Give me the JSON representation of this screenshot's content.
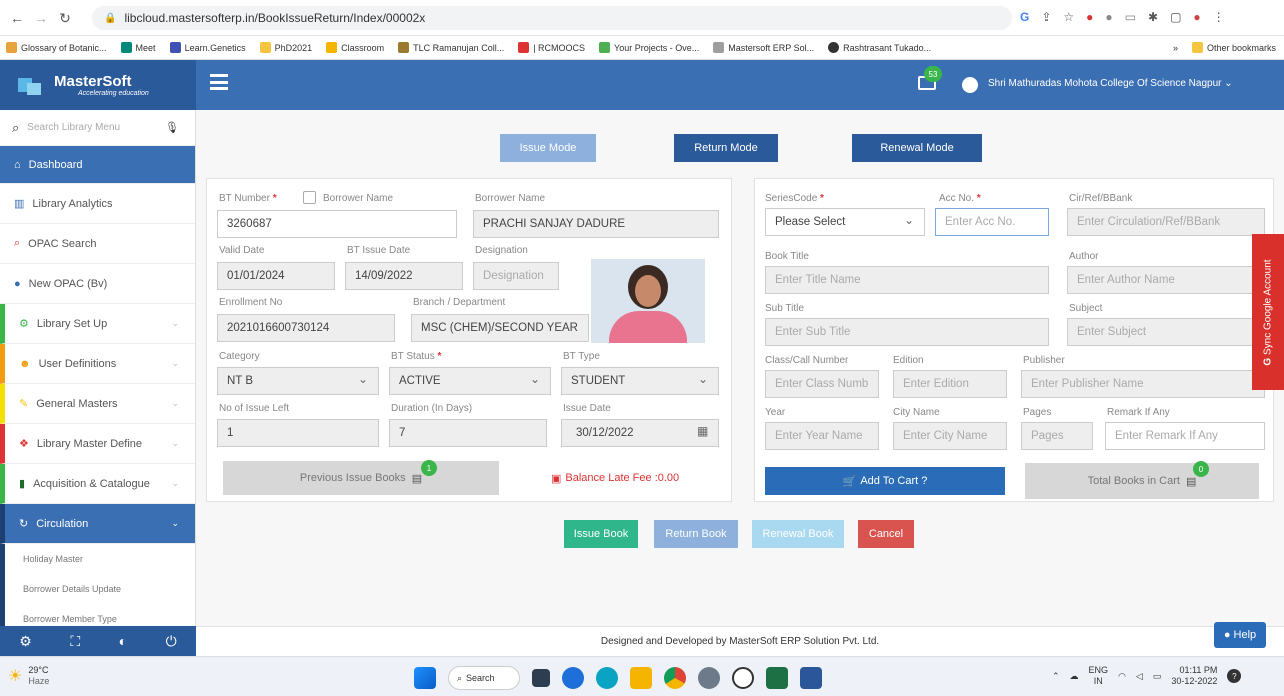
{
  "browser": {
    "url": "libcloud.mastersofterp.in/BookIssueReturn/Index/00002x",
    "bookmarks": [
      "Glossary of Botanic...",
      "Meet",
      "Learn.Genetics",
      "PhD2021",
      "Classroom",
      "TLC Ramanujan Coll...",
      "| RCMOOCS",
      "Your Projects - Ove...",
      "Mastersoft ERP Sol...",
      "Rashtrasant Tukado..."
    ],
    "other_bookmarks": "Other bookmarks"
  },
  "header": {
    "logo": "MasterSoft",
    "logo_tagline": "Accelerating education",
    "notification_count": "53",
    "college": "Shri Mathuradas Mohota College Of Science Nagpur"
  },
  "sidebar": {
    "search_placeholder": "Search Library Menu",
    "items": [
      {
        "label": "Dashboard"
      },
      {
        "label": "Library Analytics"
      },
      {
        "label": "OPAC Search"
      },
      {
        "label": "New OPAC (Bv)"
      },
      {
        "label": "Library Set Up"
      },
      {
        "label": "User Definitions"
      },
      {
        "label": "General Masters"
      },
      {
        "label": "Library Master Define"
      },
      {
        "label": "Acquisition & Catalogue"
      },
      {
        "label": "Circulation"
      }
    ],
    "sub_items": [
      "Holiday Master",
      "Borrower Details Update",
      "Borrower Member Type"
    ]
  },
  "modes": {
    "issue": "Issue Mode",
    "return": "Return Mode",
    "renewal": "Renewal Mode"
  },
  "left_form": {
    "bt_number_label": "BT Number",
    "bt_number": "3260687",
    "borrower_name_check_label": "Borrower Name",
    "borrower_name_label": "Borrower Name",
    "borrower_name": "PRACHI SANJAY DADURE",
    "valid_date_label": "Valid Date",
    "valid_date": "01/01/2024",
    "bt_issue_date_label": "BT Issue Date",
    "bt_issue_date": "14/09/2022",
    "designation_label": "Designation",
    "designation_placeholder": "Designation",
    "enrollment_label": "Enrollment No",
    "enrollment": "2021016600730124",
    "branch_label": "Branch / Department",
    "branch": "MSC (CHEM)/SECOND YEAR",
    "category_label": "Category",
    "category": "NT B",
    "bt_status_label": "BT Status",
    "bt_status": "ACTIVE",
    "bt_type_label": "BT Type",
    "bt_type": "STUDENT",
    "issue_left_label": "No of Issue Left",
    "issue_left": "1",
    "duration_label": "Duration (In Days)",
    "duration": "7",
    "issue_date_label": "Issue Date",
    "issue_date": "30/12/2022",
    "prev_issue_label": "Previous Issue Books",
    "prev_issue_count": "1",
    "late_fee": "Balance Late Fee :0.00"
  },
  "right_form": {
    "series_label": "SeriesCode",
    "series_value": "Please Select",
    "acc_label": "Acc No.",
    "acc_placeholder": "Enter Acc No.",
    "cir_label": "Cir/Ref/BBank",
    "cir_placeholder": "Enter Circulation/Ref/BBank",
    "title_label": "Book Title",
    "title_placeholder": "Enter Title Name",
    "author_label": "Author",
    "author_placeholder": "Enter Author Name",
    "subtitle_label": "Sub Title",
    "subtitle_placeholder": "Enter Sub Title",
    "subject_label": "Subject",
    "subject_placeholder": "Enter Subject",
    "class_label": "Class/Call Number",
    "class_placeholder": "Enter Class Numb",
    "edition_label": "Edition",
    "edition_placeholder": "Enter Edition",
    "publisher_label": "Publisher",
    "publisher_placeholder": "Enter Publisher Name",
    "year_label": "Year",
    "year_placeholder": "Enter Year Name",
    "city_label": "City Name",
    "city_placeholder": "Enter City Name",
    "pages_label": "Pages",
    "pages_placeholder": "Pages",
    "remark_label": "Remark If Any",
    "remark_placeholder": "Enter Remark If Any",
    "add_cart": "Add To Cart ?",
    "total_cart": "Total Books in Cart",
    "cart_count": "0"
  },
  "actions": {
    "issue": "Issue Book",
    "return": "Return Book",
    "renewal": "Renewal Book",
    "cancel": "Cancel"
  },
  "sync_tab": "Sync Google Account",
  "footer": "Designed and Developed by MasterSoft ERP Solution Pvt. Ltd.",
  "help": "Help",
  "taskbar": {
    "weather_temp": "29°C",
    "weather_desc": "Haze",
    "search": "Search",
    "lang": "ENG",
    "region": "IN",
    "time": "01:11 PM",
    "date": "30-12-2022"
  },
  "colors": {
    "primary": "#3a6fb3",
    "primary_dark": "#2b5a9a",
    "green": "#2fb68a",
    "red": "#d9534f"
  }
}
